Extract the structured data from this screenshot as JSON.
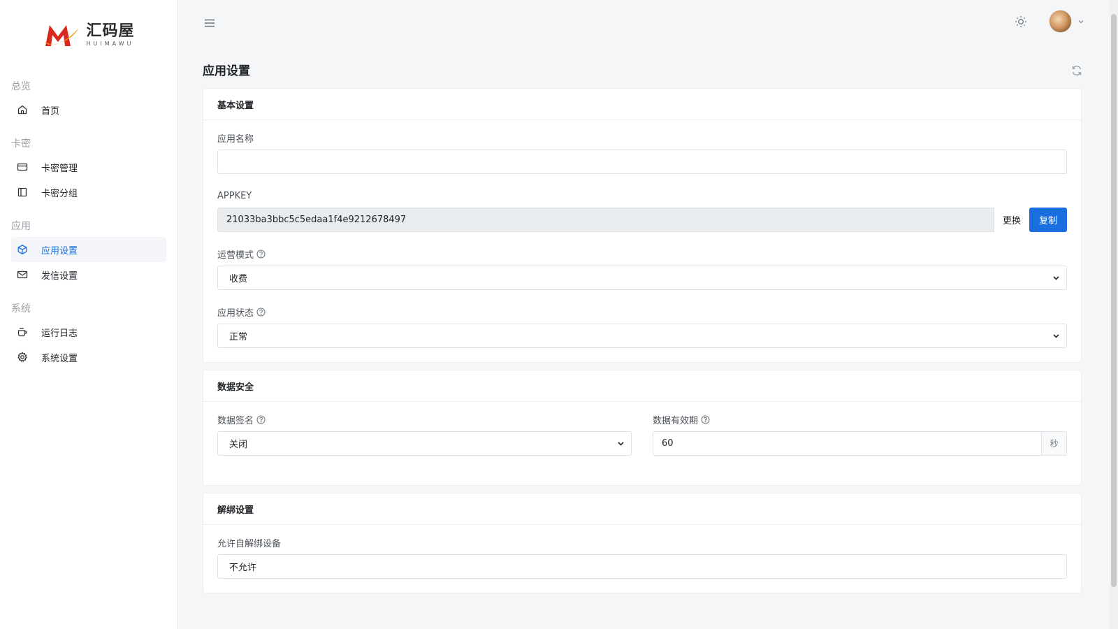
{
  "brand": {
    "name_cn": "汇码屋",
    "name_en": "HUIMAWU"
  },
  "sidebar": {
    "sections": [
      {
        "title": "总览",
        "items": [
          {
            "label": "首页",
            "icon": "home-icon"
          }
        ]
      },
      {
        "title": "卡密",
        "items": [
          {
            "label": "卡密管理",
            "icon": "card-icon"
          },
          {
            "label": "卡密分组",
            "icon": "sidebar-panel-icon"
          }
        ]
      },
      {
        "title": "应用",
        "items": [
          {
            "label": "应用设置",
            "icon": "box-icon",
            "active": true
          },
          {
            "label": "发信设置",
            "icon": "mail-icon"
          }
        ]
      },
      {
        "title": "系统",
        "items": [
          {
            "label": "运行日志",
            "icon": "cup-icon"
          },
          {
            "label": "系统设置",
            "icon": "gear-icon"
          }
        ]
      }
    ]
  },
  "colors": {
    "accent": "#1a6fe0",
    "sidebar_active_bg": "#f3f5f8",
    "page_bg": "#f5f6f8"
  },
  "page": {
    "title": "应用设置"
  },
  "basic": {
    "title": "基本设置",
    "app_name_label": "应用名称",
    "app_name_value": "",
    "appkey_label": "APPKEY",
    "appkey_value": "21033ba3bbc5c5edaa1f4e9212678497",
    "replace_label": "更换",
    "copy_label": "复制",
    "mode_label": "运营模式",
    "mode_value": "收费",
    "status_label": "应用状态",
    "status_value": "正常"
  },
  "security": {
    "title": "数据安全",
    "sign_label": "数据签名",
    "sign_value": "关闭",
    "validity_label": "数据有效期",
    "validity_value": "60",
    "validity_unit": "秒"
  },
  "unbind": {
    "title": "解绑设置",
    "self_unbind_label": "允许自解绑设备",
    "self_unbind_value": "不允许"
  }
}
